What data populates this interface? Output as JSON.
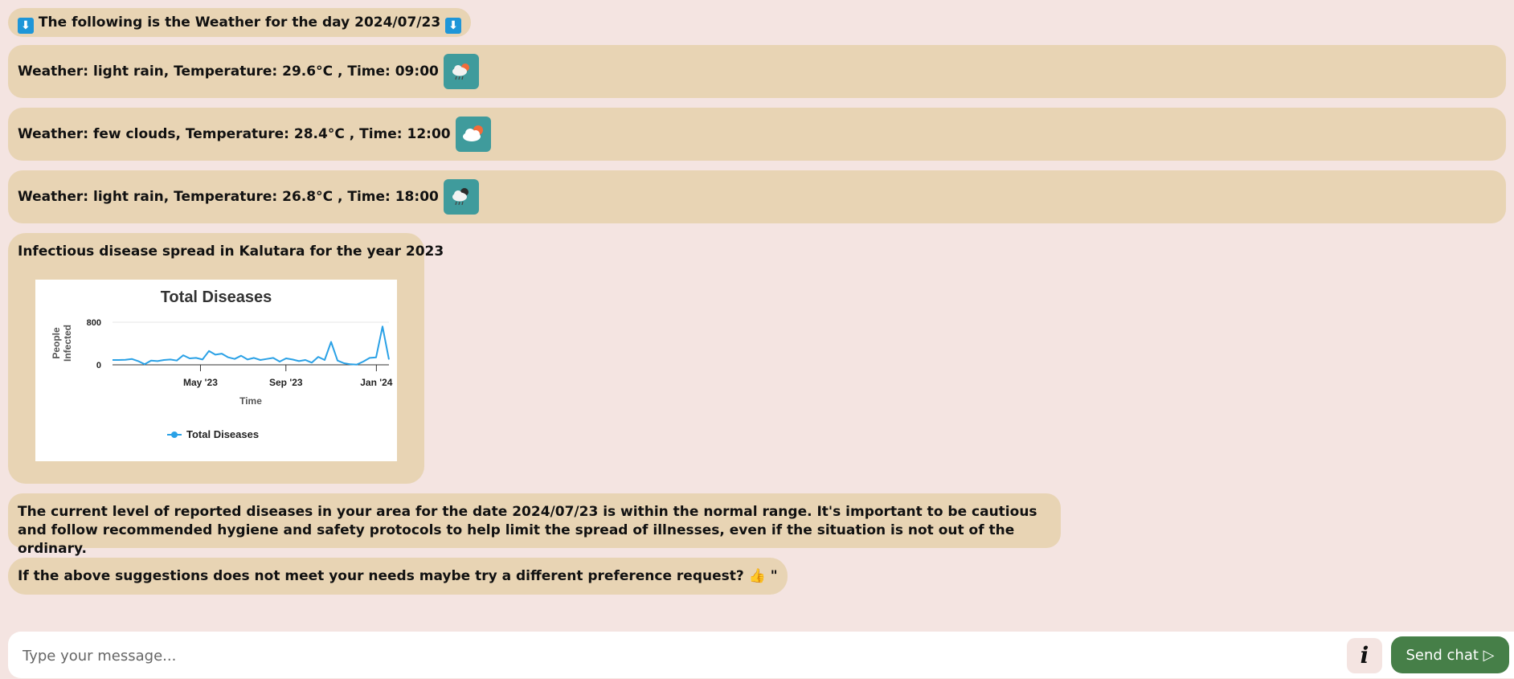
{
  "header_message": {
    "arrow_left": "⬇",
    "text": "The following is the Weather for the day 2024/07/23",
    "arrow_right": "⬇"
  },
  "weather": [
    {
      "text": "Weather: light rain, Temperature: 29.6°C , Time: 09:00",
      "icon": "light-rain-sun-icon"
    },
    {
      "text": "Weather: few clouds, Temperature: 28.4°C , Time: 12:00",
      "icon": "few-clouds-icon"
    },
    {
      "text": "Weather: light rain, Temperature: 26.8°C , Time: 18:00",
      "icon": "light-rain-moon-icon"
    }
  ],
  "disease_chart_message": {
    "text": "Infectious disease spread in Kalutara for the year 2023"
  },
  "chart_data": {
    "type": "line",
    "title": "Total Diseases",
    "xlabel": "Time",
    "ylabel": "People Infected",
    "ylim": [
      0,
      800
    ],
    "y_ticks": [
      "0",
      "800"
    ],
    "x_ticks": [
      "May '23",
      "Sep '23",
      "Jan '24"
    ],
    "x_tick_positions": [
      17.5,
      34.5,
      52.5
    ],
    "xlim": [
      0,
      55
    ],
    "grid": true,
    "legend_position": "bottom",
    "series": [
      {
        "name": "Total Diseases",
        "color": "#2aa1e6",
        "values": [
          90,
          90,
          95,
          110,
          70,
          10,
          80,
          70,
          90,
          100,
          80,
          180,
          120,
          130,
          100,
          260,
          190,
          210,
          140,
          110,
          170,
          100,
          130,
          90,
          110,
          130,
          60,
          120,
          100,
          70,
          90,
          40,
          150,
          90,
          430,
          80,
          30,
          10,
          5,
          60,
          130,
          140,
          720,
          100
        ]
      }
    ]
  },
  "advice": {
    "text": "The current level of reported diseases in your area for the date 2024/07/23 is within the normal range. It's important to be cautious and follow recommended hygiene and safety protocols to help limit the spread of illnesses, even if the situation is not out of the ordinary."
  },
  "suggestion": {
    "text": "If the above suggestions does not meet your needs maybe try a different preference request? 👍 \""
  },
  "input": {
    "placeholder": "Type your message...",
    "value": ""
  },
  "info_button": {
    "label": "i"
  },
  "send_button": {
    "label": "Send chat ▷"
  },
  "colors": {
    "background": "#f4e4e1",
    "bubble": "#e8d4b4",
    "weather_icon_bg": "#3f9b9c",
    "send_button": "#467f48",
    "chart_line": "#2aa1e6"
  }
}
